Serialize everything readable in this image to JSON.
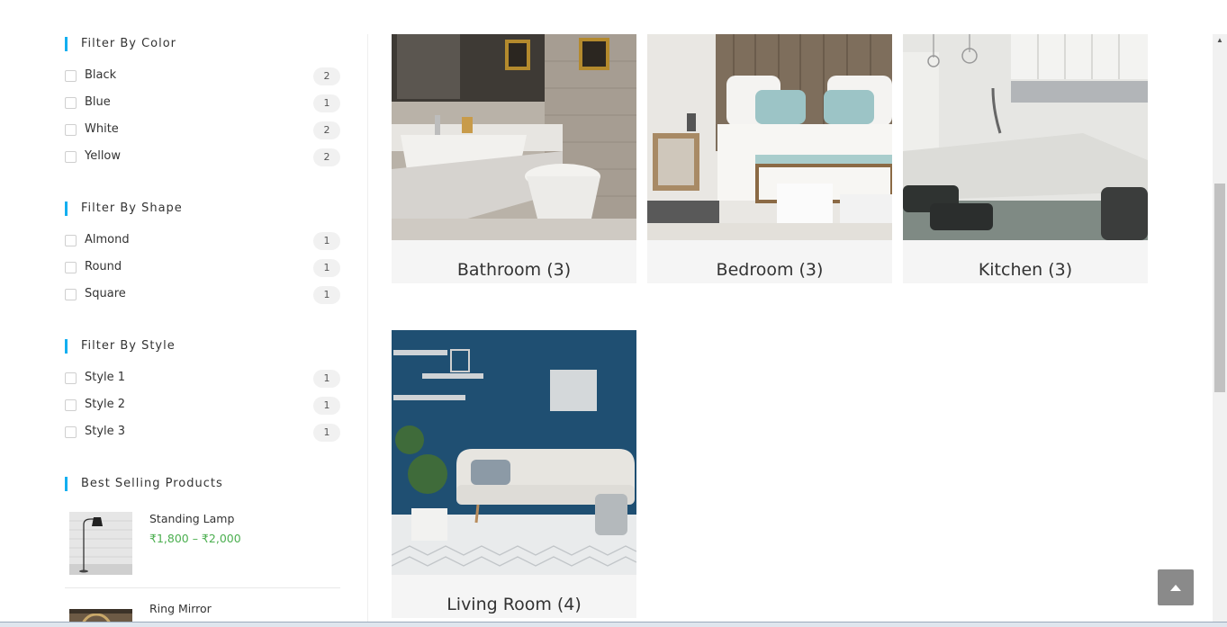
{
  "filters": {
    "color": {
      "title": "Filter By Color",
      "items": [
        {
          "label": "Black",
          "count": "2"
        },
        {
          "label": "Blue",
          "count": "1"
        },
        {
          "label": "White",
          "count": "2"
        },
        {
          "label": "Yellow",
          "count": "2"
        }
      ]
    },
    "shape": {
      "title": "Filter By Shape",
      "items": [
        {
          "label": "Almond",
          "count": "1"
        },
        {
          "label": "Round",
          "count": "1"
        },
        {
          "label": "Square",
          "count": "1"
        }
      ]
    },
    "style": {
      "title": "Filter By Style",
      "items": [
        {
          "label": "Style 1",
          "count": "1"
        },
        {
          "label": "Style 2",
          "count": "1"
        },
        {
          "label": "Style 3",
          "count": "1"
        }
      ]
    }
  },
  "best_selling": {
    "title": "Best Selling Products",
    "products": [
      {
        "name": "Standing Lamp",
        "price": "₹1,800 – ₹2,000"
      },
      {
        "name": "Ring Mirror",
        "price": ""
      }
    ]
  },
  "categories": [
    {
      "title": "Bathroom (3)"
    },
    {
      "title": "Bedroom (3)"
    },
    {
      "title": "Kitchen (3)"
    },
    {
      "title": "Living Room (4)"
    }
  ],
  "colors": {
    "accent": "#13aff0",
    "price": "#4caf50",
    "card_bg": "#f5f5f5",
    "back_to_top": "#8a8a8a"
  },
  "icons": {
    "back_to_top": "chevron-up-icon",
    "scroll_up": "scroll-up-arrow-icon"
  }
}
